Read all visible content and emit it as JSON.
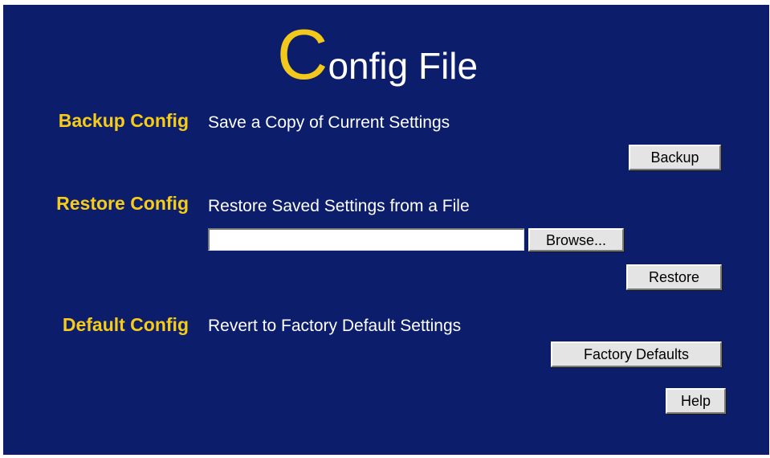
{
  "title": {
    "first_letter": "C",
    "rest": "onfig File"
  },
  "backup": {
    "label": "Backup Config",
    "description": "Save a Copy of Current Settings",
    "button": "Backup"
  },
  "restore": {
    "label": "Restore Config",
    "description": "Restore Saved Settings from a File",
    "file_value": "",
    "browse_button": "Browse...",
    "button": "Restore"
  },
  "default": {
    "label": "Default Config",
    "description": "Revert to Factory Default Settings",
    "button": "Factory Defaults"
  },
  "help_button": "Help",
  "colors": {
    "background": "#0c1d6c",
    "accent": "#f6cc18",
    "text": "#ffffff"
  }
}
